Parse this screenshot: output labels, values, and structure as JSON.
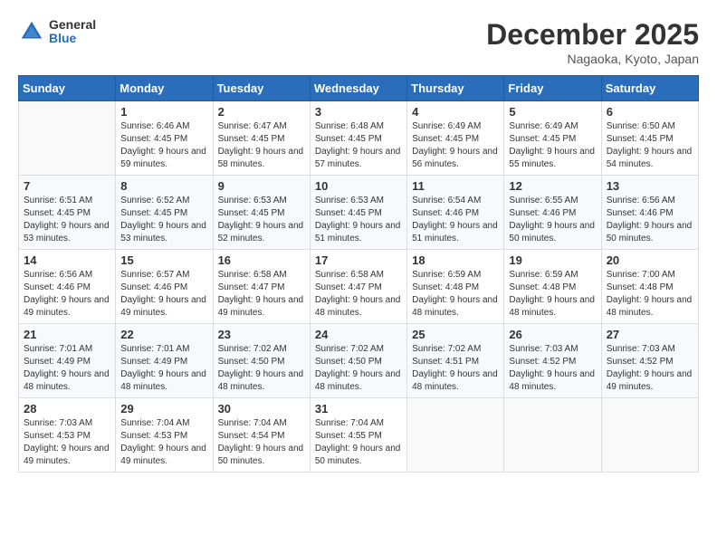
{
  "header": {
    "logo_general": "General",
    "logo_blue": "Blue",
    "month_title": "December 2025",
    "location": "Nagaoka, Kyoto, Japan"
  },
  "weekdays": [
    "Sunday",
    "Monday",
    "Tuesday",
    "Wednesday",
    "Thursday",
    "Friday",
    "Saturday"
  ],
  "weeks": [
    [
      {
        "day": "",
        "sunrise": "",
        "sunset": "",
        "daylight": ""
      },
      {
        "day": "1",
        "sunrise": "Sunrise: 6:46 AM",
        "sunset": "Sunset: 4:45 PM",
        "daylight": "Daylight: 9 hours and 59 minutes."
      },
      {
        "day": "2",
        "sunrise": "Sunrise: 6:47 AM",
        "sunset": "Sunset: 4:45 PM",
        "daylight": "Daylight: 9 hours and 58 minutes."
      },
      {
        "day": "3",
        "sunrise": "Sunrise: 6:48 AM",
        "sunset": "Sunset: 4:45 PM",
        "daylight": "Daylight: 9 hours and 57 minutes."
      },
      {
        "day": "4",
        "sunrise": "Sunrise: 6:49 AM",
        "sunset": "Sunset: 4:45 PM",
        "daylight": "Daylight: 9 hours and 56 minutes."
      },
      {
        "day": "5",
        "sunrise": "Sunrise: 6:49 AM",
        "sunset": "Sunset: 4:45 PM",
        "daylight": "Daylight: 9 hours and 55 minutes."
      },
      {
        "day": "6",
        "sunrise": "Sunrise: 6:50 AM",
        "sunset": "Sunset: 4:45 PM",
        "daylight": "Daylight: 9 hours and 54 minutes."
      }
    ],
    [
      {
        "day": "7",
        "sunrise": "Sunrise: 6:51 AM",
        "sunset": "Sunset: 4:45 PM",
        "daylight": "Daylight: 9 hours and 53 minutes."
      },
      {
        "day": "8",
        "sunrise": "Sunrise: 6:52 AM",
        "sunset": "Sunset: 4:45 PM",
        "daylight": "Daylight: 9 hours and 53 minutes."
      },
      {
        "day": "9",
        "sunrise": "Sunrise: 6:53 AM",
        "sunset": "Sunset: 4:45 PM",
        "daylight": "Daylight: 9 hours and 52 minutes."
      },
      {
        "day": "10",
        "sunrise": "Sunrise: 6:53 AM",
        "sunset": "Sunset: 4:45 PM",
        "daylight": "Daylight: 9 hours and 51 minutes."
      },
      {
        "day": "11",
        "sunrise": "Sunrise: 6:54 AM",
        "sunset": "Sunset: 4:46 PM",
        "daylight": "Daylight: 9 hours and 51 minutes."
      },
      {
        "day": "12",
        "sunrise": "Sunrise: 6:55 AM",
        "sunset": "Sunset: 4:46 PM",
        "daylight": "Daylight: 9 hours and 50 minutes."
      },
      {
        "day": "13",
        "sunrise": "Sunrise: 6:56 AM",
        "sunset": "Sunset: 4:46 PM",
        "daylight": "Daylight: 9 hours and 50 minutes."
      }
    ],
    [
      {
        "day": "14",
        "sunrise": "Sunrise: 6:56 AM",
        "sunset": "Sunset: 4:46 PM",
        "daylight": "Daylight: 9 hours and 49 minutes."
      },
      {
        "day": "15",
        "sunrise": "Sunrise: 6:57 AM",
        "sunset": "Sunset: 4:46 PM",
        "daylight": "Daylight: 9 hours and 49 minutes."
      },
      {
        "day": "16",
        "sunrise": "Sunrise: 6:58 AM",
        "sunset": "Sunset: 4:47 PM",
        "daylight": "Daylight: 9 hours and 49 minutes."
      },
      {
        "day": "17",
        "sunrise": "Sunrise: 6:58 AM",
        "sunset": "Sunset: 4:47 PM",
        "daylight": "Daylight: 9 hours and 48 minutes."
      },
      {
        "day": "18",
        "sunrise": "Sunrise: 6:59 AM",
        "sunset": "Sunset: 4:48 PM",
        "daylight": "Daylight: 9 hours and 48 minutes."
      },
      {
        "day": "19",
        "sunrise": "Sunrise: 6:59 AM",
        "sunset": "Sunset: 4:48 PM",
        "daylight": "Daylight: 9 hours and 48 minutes."
      },
      {
        "day": "20",
        "sunrise": "Sunrise: 7:00 AM",
        "sunset": "Sunset: 4:48 PM",
        "daylight": "Daylight: 9 hours and 48 minutes."
      }
    ],
    [
      {
        "day": "21",
        "sunrise": "Sunrise: 7:01 AM",
        "sunset": "Sunset: 4:49 PM",
        "daylight": "Daylight: 9 hours and 48 minutes."
      },
      {
        "day": "22",
        "sunrise": "Sunrise: 7:01 AM",
        "sunset": "Sunset: 4:49 PM",
        "daylight": "Daylight: 9 hours and 48 minutes."
      },
      {
        "day": "23",
        "sunrise": "Sunrise: 7:02 AM",
        "sunset": "Sunset: 4:50 PM",
        "daylight": "Daylight: 9 hours and 48 minutes."
      },
      {
        "day": "24",
        "sunrise": "Sunrise: 7:02 AM",
        "sunset": "Sunset: 4:50 PM",
        "daylight": "Daylight: 9 hours and 48 minutes."
      },
      {
        "day": "25",
        "sunrise": "Sunrise: 7:02 AM",
        "sunset": "Sunset: 4:51 PM",
        "daylight": "Daylight: 9 hours and 48 minutes."
      },
      {
        "day": "26",
        "sunrise": "Sunrise: 7:03 AM",
        "sunset": "Sunset: 4:52 PM",
        "daylight": "Daylight: 9 hours and 48 minutes."
      },
      {
        "day": "27",
        "sunrise": "Sunrise: 7:03 AM",
        "sunset": "Sunset: 4:52 PM",
        "daylight": "Daylight: 9 hours and 49 minutes."
      }
    ],
    [
      {
        "day": "28",
        "sunrise": "Sunrise: 7:03 AM",
        "sunset": "Sunset: 4:53 PM",
        "daylight": "Daylight: 9 hours and 49 minutes."
      },
      {
        "day": "29",
        "sunrise": "Sunrise: 7:04 AM",
        "sunset": "Sunset: 4:53 PM",
        "daylight": "Daylight: 9 hours and 49 minutes."
      },
      {
        "day": "30",
        "sunrise": "Sunrise: 7:04 AM",
        "sunset": "Sunset: 4:54 PM",
        "daylight": "Daylight: 9 hours and 50 minutes."
      },
      {
        "day": "31",
        "sunrise": "Sunrise: 7:04 AM",
        "sunset": "Sunset: 4:55 PM",
        "daylight": "Daylight: 9 hours and 50 minutes."
      },
      {
        "day": "",
        "sunrise": "",
        "sunset": "",
        "daylight": ""
      },
      {
        "day": "",
        "sunrise": "",
        "sunset": "",
        "daylight": ""
      },
      {
        "day": "",
        "sunrise": "",
        "sunset": "",
        "daylight": ""
      }
    ]
  ]
}
